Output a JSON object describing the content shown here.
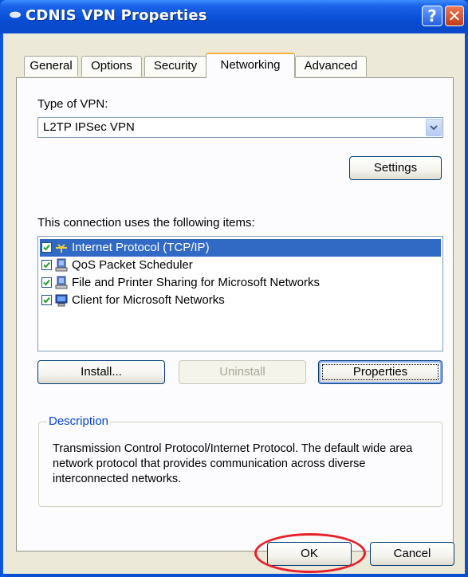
{
  "window": {
    "title": "CDNIS VPN Properties",
    "help_label": "?",
    "close_label": "✕"
  },
  "tabs": [
    {
      "label": "General"
    },
    {
      "label": "Options"
    },
    {
      "label": "Security"
    },
    {
      "label": "Networking",
      "active": true
    },
    {
      "label": "Advanced"
    }
  ],
  "networking": {
    "vpn_type_label": "Type of VPN:",
    "vpn_type_value": "L2TP IPSec VPN",
    "settings_label": "Settings",
    "items_label": "This connection uses the following items:",
    "items": [
      {
        "label": "Internet Protocol (TCP/IP)",
        "checked": true,
        "selected": true,
        "icon": "network-protocol-icon"
      },
      {
        "label": "QoS Packet Scheduler",
        "checked": true,
        "icon": "network-service-icon"
      },
      {
        "label": "File and Printer Sharing for Microsoft Networks",
        "checked": true,
        "icon": "network-service-icon"
      },
      {
        "label": "Client for Microsoft Networks",
        "checked": true,
        "icon": "network-client-icon"
      }
    ],
    "install_label": "Install...",
    "uninstall_label": "Uninstall",
    "properties_label": "Properties",
    "description_title": "Description",
    "description_text": "Transmission Control Protocol/Internet Protocol. The default wide area network protocol that provides communication across diverse interconnected networks."
  },
  "footer": {
    "ok_label": "OK",
    "cancel_label": "Cancel"
  },
  "colors": {
    "titlebar": "#0a4fd6",
    "selection": "#316ac5",
    "dialog_bg": "#ece9d8",
    "highlight_ring": "#e8202a",
    "group_title": "#0046d5"
  }
}
